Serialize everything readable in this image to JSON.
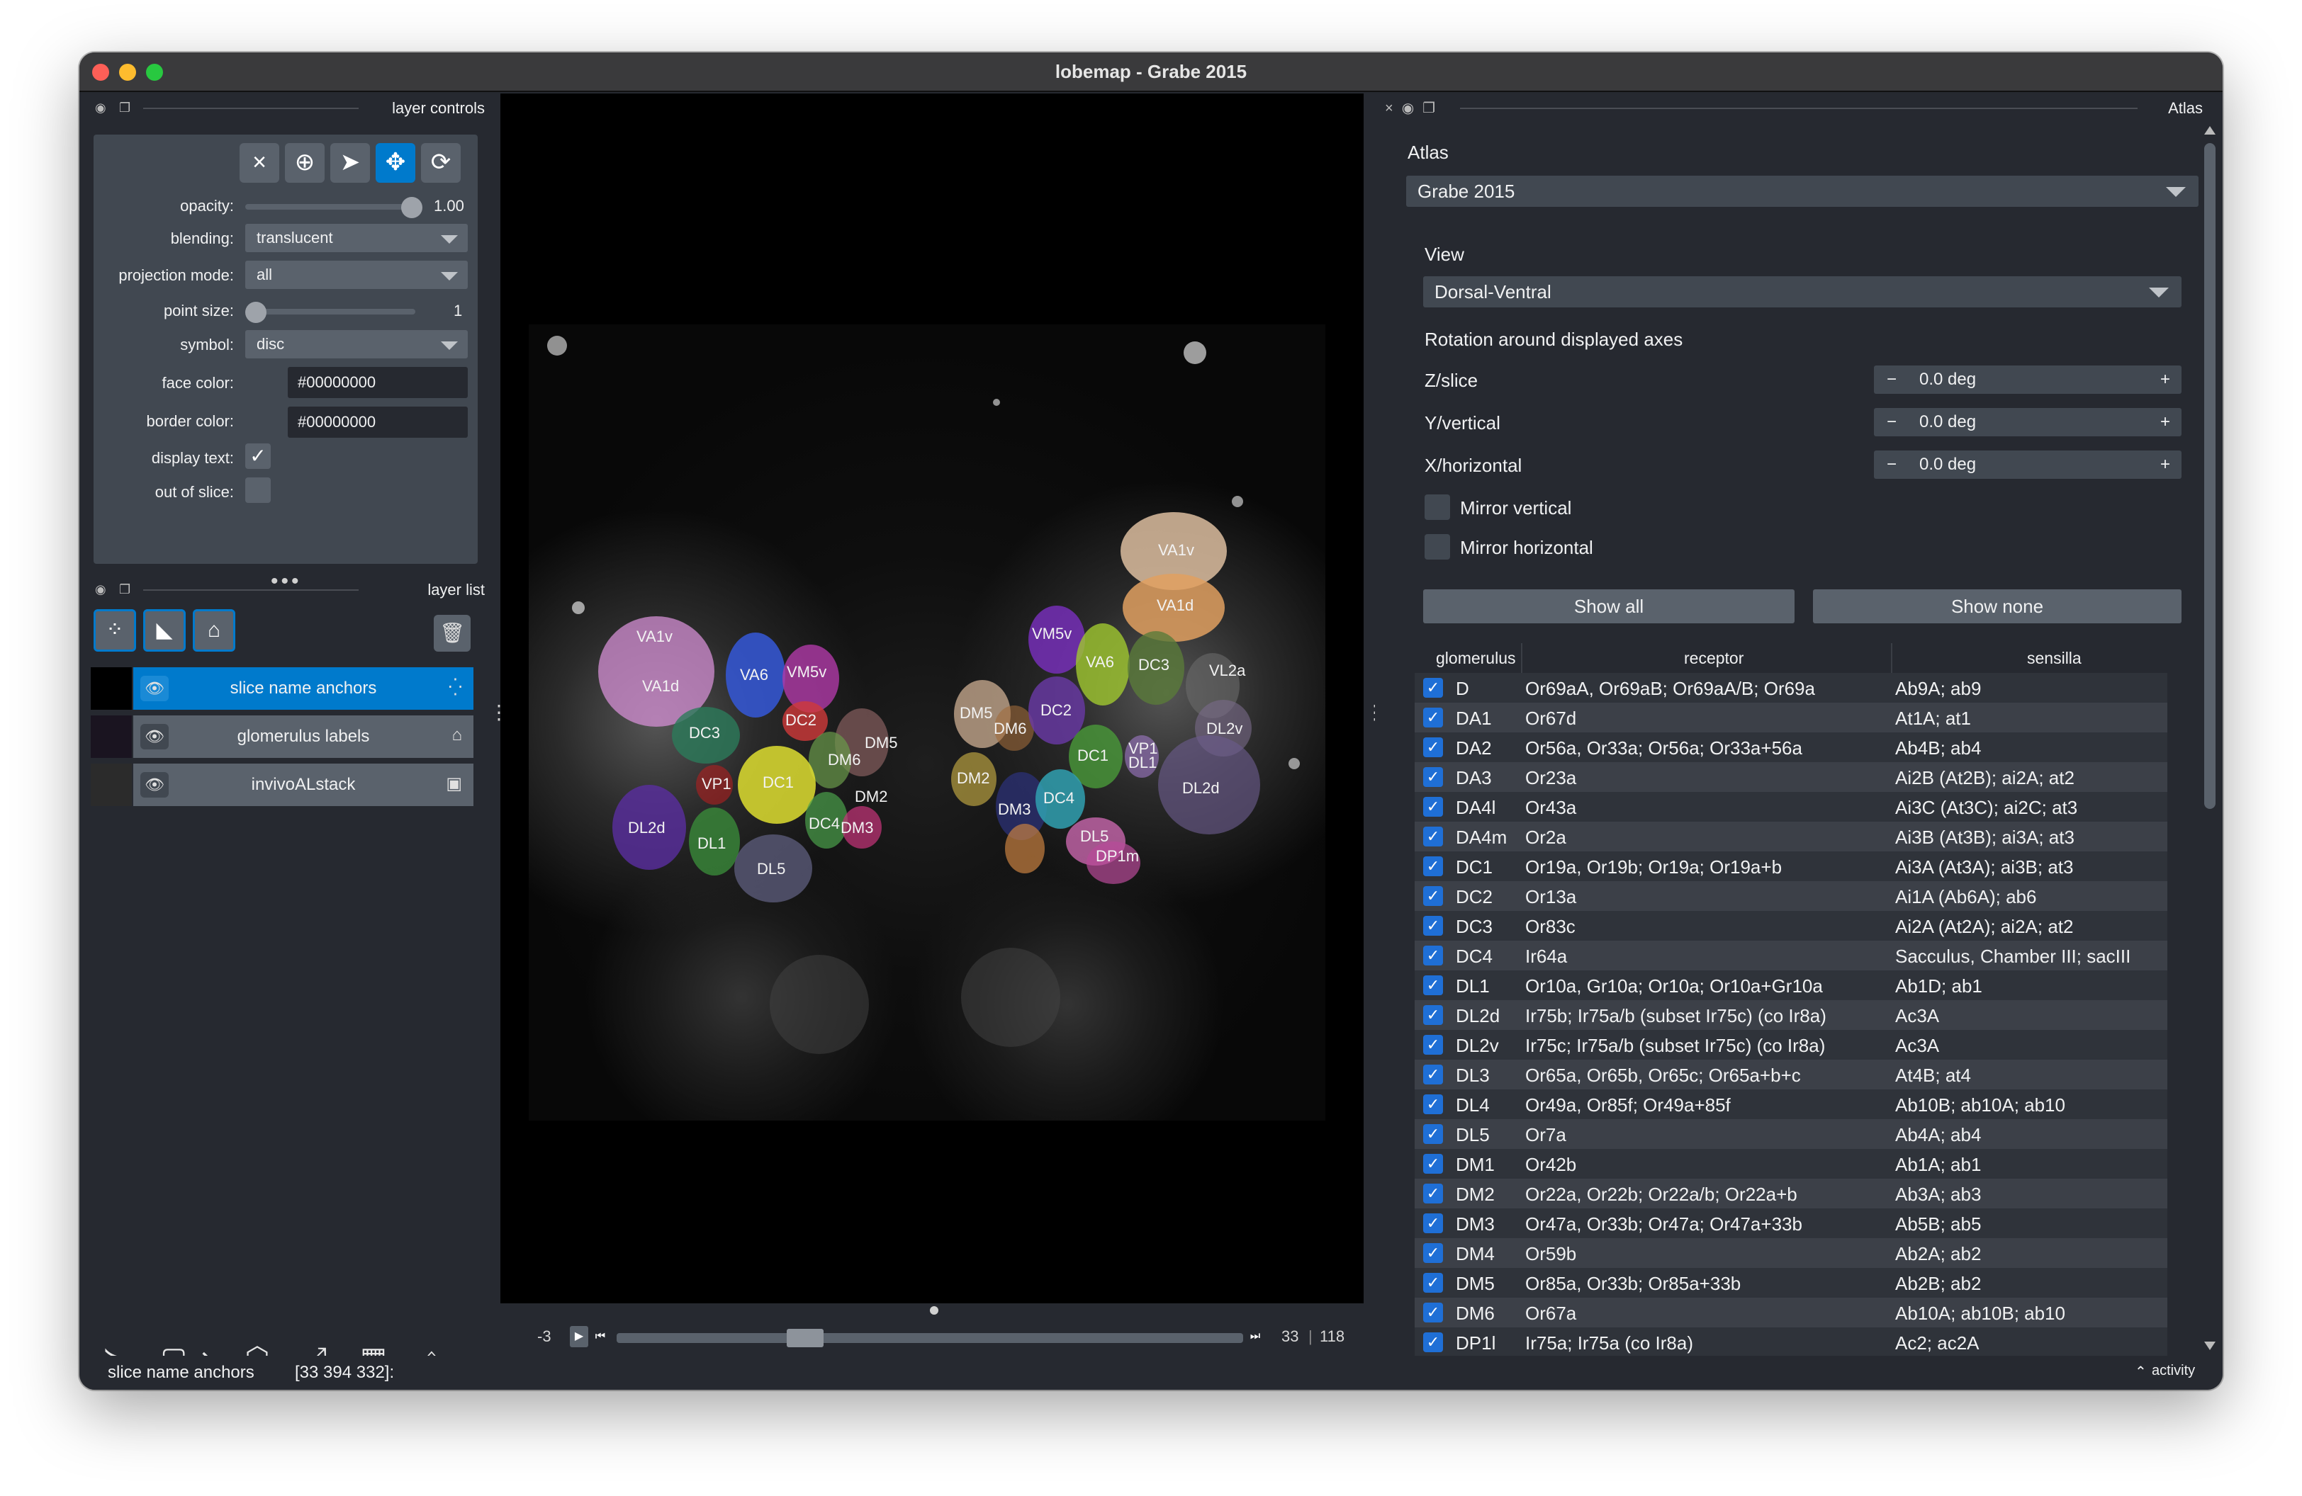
{
  "window": {
    "title": "lobemap - Grabe 2015"
  },
  "layer_controls": {
    "title": "layer controls",
    "opacity_label": "opacity:",
    "opacity_value": "1.00",
    "opacity": 1.0,
    "blending_label": "blending:",
    "blending_value": "translucent",
    "projection_label": "projection mode:",
    "projection_value": "all",
    "point_size_label": "point size:",
    "point_size_value": "1",
    "symbol_label": "symbol:",
    "symbol_value": "disc",
    "face_color_label": "face color:",
    "face_color_value": "#00000000",
    "border_color_label": "border color:",
    "border_color_value": "#00000000",
    "display_text_label": "display text:",
    "display_text_checked": true,
    "out_of_slice_label": "out of slice:",
    "out_of_slice_checked": false,
    "tools": [
      "close-icon",
      "add-point-icon",
      "select-arrow-icon",
      "pan-zoom-icon",
      "transform-icon"
    ]
  },
  "layer_list": {
    "title": "layer list",
    "buttons": [
      "new-points-layer-icon",
      "new-shapes-layer-icon",
      "new-labels-layer-icon",
      "delete-layer-icon"
    ],
    "layers": [
      {
        "name": "slice name anchors",
        "type_icon": "points-icon",
        "selected": true
      },
      {
        "name": "glomerulus labels",
        "type_icon": "labels-icon",
        "selected": false
      },
      {
        "name": "invivoALstack",
        "type_icon": "image-icon",
        "selected": false
      }
    ]
  },
  "bottom_tools": [
    "console-icon",
    "2d-3d-toggle-icon",
    "roll-dimensions-icon",
    "transpose-icon",
    "grid-icon",
    "home-icon"
  ],
  "dims_slider": {
    "left_label": "-3",
    "current": "33",
    "total": "118",
    "value": 33,
    "max": 118
  },
  "status_bar": {
    "layer": "slice name anchors",
    "coords": "[33 394 332]:",
    "activity": "activity"
  },
  "image_labels": [
    "VA1v",
    "VA1d",
    "VA6",
    "VM5v",
    "DC3",
    "DC2",
    "DM5",
    "DM6",
    "VP1",
    "DC1",
    "DM2",
    "DL2d",
    "DL1",
    "DC4",
    "DM3",
    "DL5",
    "VA1v",
    "VA1d",
    "VM5v",
    "VA6",
    "DC3",
    "VL2a",
    "DM5",
    "DM6",
    "DC2",
    "DL2v",
    "VP1",
    "DL1",
    "DC1",
    "DM2",
    "DC4",
    "DM3",
    "DL2d",
    "DL5",
    "DP1m"
  ],
  "atlas_panel": {
    "title": "Atlas",
    "atlas_label": "Atlas",
    "atlas_value": "Grabe 2015",
    "view_label": "View",
    "view_value": "Dorsal-Ventral",
    "rotation_label": "Rotation around displayed axes",
    "axes": [
      {
        "label": "Z/slice",
        "value": "0.0 deg"
      },
      {
        "label": "Y/vertical",
        "value": "0.0 deg"
      },
      {
        "label": "X/horizontal",
        "value": "0.0 deg"
      }
    ],
    "spin_minus": "−",
    "spin_plus": "+",
    "mirror_vertical": "Mirror vertical",
    "mirror_horizontal": "Mirror horizontal",
    "show_all": "Show all",
    "show_none": "Show none",
    "table": {
      "headers": [
        "glomerulus",
        "receptor",
        "sensilla"
      ],
      "rows": [
        {
          "g": "D",
          "r": "Or69aA, Or69aB; Or69aA/B; Or69a",
          "s": "Ab9A; ab9"
        },
        {
          "g": "DA1",
          "r": "Or67d",
          "s": "At1A; at1"
        },
        {
          "g": "DA2",
          "r": "Or56a, Or33a; Or56a; Or33a+56a",
          "s": "Ab4B; ab4"
        },
        {
          "g": "DA3",
          "r": "Or23a",
          "s": "Ai2B (At2B); ai2A; at2"
        },
        {
          "g": "DA4l",
          "r": "Or43a",
          "s": "Ai3C (At3C); ai2C; at3"
        },
        {
          "g": "DA4m",
          "r": "Or2a",
          "s": "Ai3B (At3B); ai3A; at3"
        },
        {
          "g": "DC1",
          "r": "Or19a, Or19b; Or19a; Or19a+b",
          "s": "Ai3A (At3A); ai3B; at3"
        },
        {
          "g": "DC2",
          "r": "Or13a",
          "s": "Ai1A (Ab6A); ab6"
        },
        {
          "g": "DC3",
          "r": "Or83c",
          "s": "Ai2A (At2A); ai2A; at2"
        },
        {
          "g": "DC4",
          "r": "Ir64a",
          "s": "Sacculus, Chamber III; sacIII"
        },
        {
          "g": "DL1",
          "r": "Or10a, Gr10a; Or10a; Or10a+Gr10a",
          "s": "Ab1D; ab1"
        },
        {
          "g": "DL2d",
          "r": "Ir75b; Ir75a/b (subset Ir75c) (co Ir8a)",
          "s": "Ac3A"
        },
        {
          "g": "DL2v",
          "r": "Ir75c; Ir75a/b (subset Ir75c) (co Ir8a)",
          "s": "Ac3A"
        },
        {
          "g": "DL3",
          "r": "Or65a, Or65b, Or65c; Or65a+b+c",
          "s": "At4B; at4"
        },
        {
          "g": "DL4",
          "r": "Or49a, Or85f; Or49a+85f",
          "s": "Ab10B; ab10A; ab10"
        },
        {
          "g": "DL5",
          "r": "Or7a",
          "s": "Ab4A; ab4"
        },
        {
          "g": "DM1",
          "r": "Or42b",
          "s": "Ab1A; ab1"
        },
        {
          "g": "DM2",
          "r": "Or22a, Or22b; Or22a/b; Or22a+b",
          "s": "Ab3A; ab3"
        },
        {
          "g": "DM3",
          "r": "Or47a, Or33b; Or47a; Or47a+33b",
          "s": "Ab5B; ab5"
        },
        {
          "g": "DM4",
          "r": "Or59b",
          "s": "Ab2A; ab2"
        },
        {
          "g": "DM5",
          "r": "Or85a, Or33b; Or85a+33b",
          "s": "Ab2B; ab2"
        },
        {
          "g": "DM6",
          "r": "Or67a",
          "s": "Ab10A; ab10B; ab10"
        },
        {
          "g": "DP1l",
          "r": "Ir75a; Ir75a (co Ir8a)",
          "s": "Ac2; ac2A"
        }
      ]
    }
  },
  "colors": {
    "accent": "#007acc",
    "panel": "#262930",
    "control": "#414851",
    "button": "#5a626c"
  }
}
